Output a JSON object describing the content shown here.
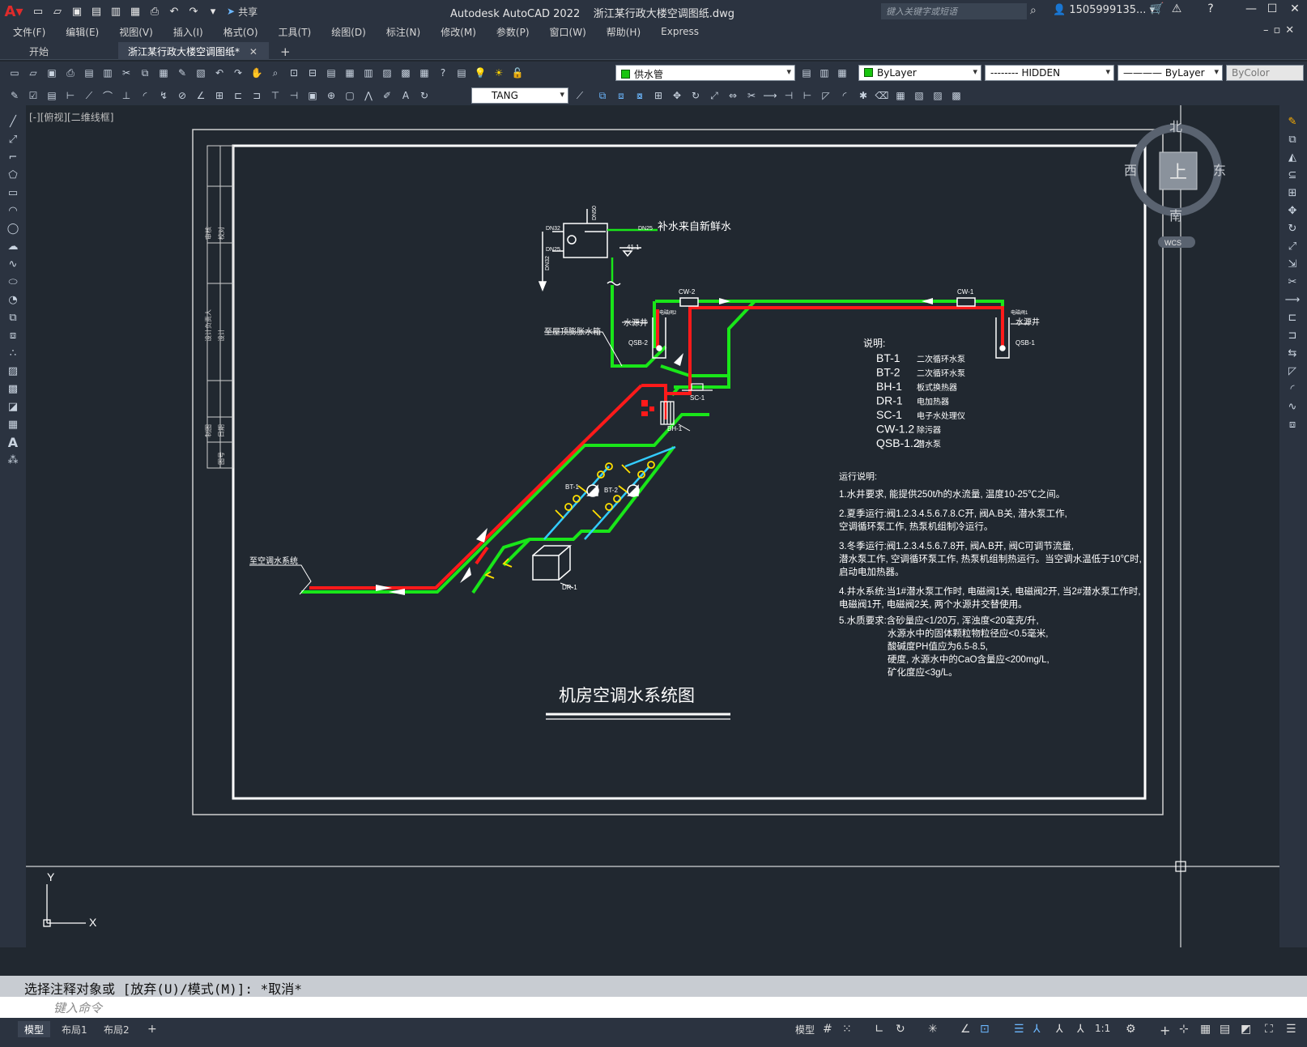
{
  "app": {
    "title": "Autodesk AutoCAD 2022",
    "filename": "浙江某行政大楼空调图纸.dwg",
    "share_label": "共享",
    "search_placeholder": "键入关键字或短语",
    "user": "1505999135..."
  },
  "menu": [
    "文件(F)",
    "编辑(E)",
    "视图(V)",
    "插入(I)",
    "格式(O)",
    "工具(T)",
    "绘图(D)",
    "标注(N)",
    "修改(M)",
    "参数(P)",
    "窗口(W)",
    "帮助(H)",
    "Express"
  ],
  "tabs": {
    "start": "开始",
    "active": "浙江某行政大楼空调图纸*"
  },
  "properties": {
    "layer": "供水管",
    "color": "ByLayer",
    "linetype": "-------- HIDDEN",
    "lineweight": "———— ByLayer",
    "plotstyle": "ByColor",
    "textstyle": "TANG"
  },
  "viewport_label": "[-][俯视][二维线框]",
  "viewcube": {
    "north": "北",
    "south": "南",
    "east": "东",
    "west": "西",
    "top": "上",
    "wcs": "WCS"
  },
  "drawing": {
    "title": "机房空调水系统图",
    "labels": {
      "makeup_water": "补水来自新鲜水",
      "to_roof_tank": "至屋顶膨胀水箱",
      "to_ac_system": "至空调水系统",
      "water_well_left": "水源井",
      "water_well_right": "水源井",
      "qsb2": "QSB-2",
      "qsb1": "QSB-1",
      "cw2": "CW-2",
      "cw1": "CW-1",
      "bh1": "BH-1",
      "sc1": "SC-1",
      "dr1": "DR-1",
      "bt1": "BT-1",
      "bt2": "BT-2",
      "dn32": "DN32",
      "dn25a": "DN25",
      "dn25b": "DN25",
      "dn50": "DN50",
      "dn32b": "DN32",
      "elev": "41.1",
      "valve_m2": "电磁阀2",
      "valve_m1": "电磁阀1"
    },
    "legend_title": "说明:",
    "legend": [
      [
        "BT-1",
        "二次循环水泵"
      ],
      [
        "BT-2",
        "二次循环水泵"
      ],
      [
        "BH-1",
        "板式换热器"
      ],
      [
        "DR-1",
        "电加热器"
      ],
      [
        "SC-1",
        "电子水处理仪"
      ],
      [
        "CW-1.2",
        "除污器"
      ],
      [
        "QSB-1.2",
        "潜水泵"
      ]
    ],
    "notes_title": "运行说明:",
    "notes": [
      "1.水井要求, 能提供250t/h的水流量, 温度10-25℃之间。",
      "2.夏季运行:阀1.2.3.4.5.6.7.8.C开, 阀A.B关, 潜水泵工作,",
      "空调循环泵工作, 热泵机组制冷运行。",
      "3.冬季运行:阀1.2.3.4.5.6.7.8开, 阀A.B开, 阀C可调节流量,",
      "潜水泵工作, 空调循环泵工作, 热泵机组制热运行。当空调水温低于10℃时,",
      "启动电加热器。",
      "4.井水系统:当1#潜水泵工作时, 电磁阀1关, 电磁阀2开, 当2#潜水泵工作时,",
      "电磁阀1开, 电磁阀2关, 两个水源井交替使用。",
      "5.水质要求:含砂量应<1/20万, 浑浊度<20毫克/升,",
      "水源水中的固体颗粒物粒径应<0.5毫米,",
      "酸碱度PH值应为6.5-8.5,",
      "硬度, 水源水中的CaO含量应<200mg/L,",
      "矿化度应<3g/L。"
    ],
    "title_block": [
      "审核",
      "校对",
      "设计负责人",
      "设计",
      "制图",
      "日期",
      "图号"
    ]
  },
  "command": {
    "history": "选择注释对象或 [放弃(U)/模式(M)]: *取消*",
    "placeholder": "键入命令"
  },
  "status": {
    "layouts": [
      "模型",
      "布局1",
      "布局2"
    ],
    "model_label": "模型",
    "scale": "1:1"
  },
  "colors": {
    "supply": "#ff1a1a",
    "return": "#19e619",
    "aux": "#33ccff",
    "valve": "#ffe000",
    "background": "#212830",
    "frame": "#ffffff"
  }
}
